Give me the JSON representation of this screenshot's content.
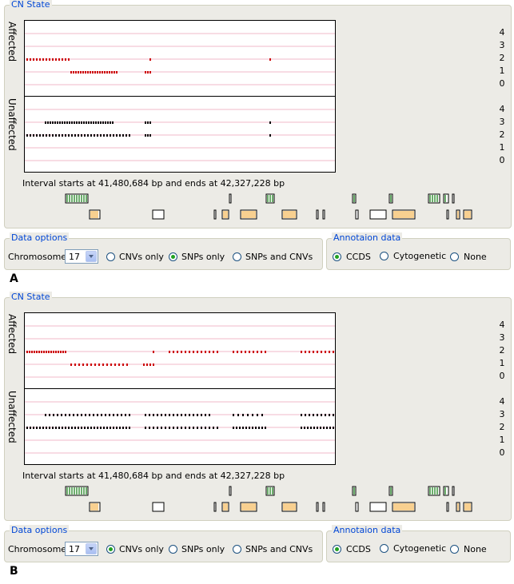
{
  "panels": [
    {
      "letter": "A",
      "cn_state_title": "CN State",
      "affected_label": "Affected",
      "unaffected_label": "Unaffected",
      "y_ticks": [
        "4",
        "3",
        "2",
        "1",
        "0"
      ],
      "interval_text": "Interval starts at 41,480,684 bp and ends at 42,327,228 bp",
      "data_options": {
        "title": "Data options",
        "chromosome_label": "Chromosome",
        "chromosome_value": "17",
        "radios": [
          {
            "label": "CNVs only",
            "checked": false
          },
          {
            "label": "SNPs only",
            "checked": true
          },
          {
            "label": "SNPs and CNVs",
            "checked": false
          }
        ]
      },
      "annotation": {
        "title": "Annotaion data",
        "radios": [
          {
            "label": "CCDS",
            "checked": true
          },
          {
            "label": "Cytogenetic",
            "checked": false
          },
          {
            "label": "None",
            "checked": false
          }
        ]
      }
    },
    {
      "letter": "B",
      "cn_state_title": "CN State",
      "affected_label": "Affected",
      "unaffected_label": "Unaffected",
      "y_ticks": [
        "4",
        "3",
        "2",
        "1",
        "0"
      ],
      "interval_text": "Interval starts at 41,480,684 bp and ends at 42,327,228 bp",
      "data_options": {
        "title": "Data options",
        "chromosome_label": "Chromosome",
        "chromosome_value": "17",
        "radios": [
          {
            "label": "CNVs only",
            "checked": true
          },
          {
            "label": "SNPs only",
            "checked": false
          },
          {
            "label": "SNPs and CNVs",
            "checked": false
          }
        ]
      },
      "annotation": {
        "title": "Annotaion data",
        "radios": [
          {
            "label": "CCDS",
            "checked": true
          },
          {
            "label": "Cytogenetic",
            "checked": false
          },
          {
            "label": "None",
            "checked": false
          }
        ]
      }
    }
  ],
  "colors": {
    "affected": "#cc0000",
    "unaffected": "#000000",
    "grid": "#f2b8c8",
    "ccds_green": "#2e8b2e",
    "cyto_orange": "#f0a020"
  }
}
